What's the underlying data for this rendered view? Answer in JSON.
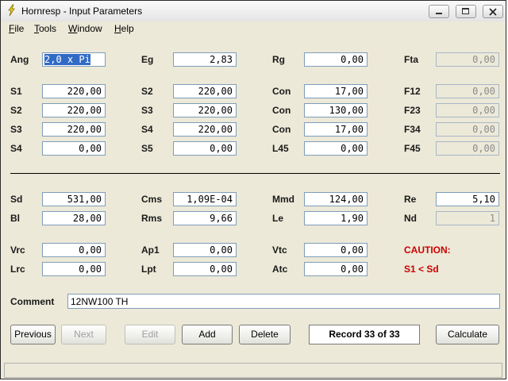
{
  "window": {
    "title": "Hornresp - Input Parameters"
  },
  "menu": [
    "File",
    "Tools",
    "Window",
    "Help"
  ],
  "params": [
    {
      "label": "Ang",
      "value": "2,0 x Pi",
      "state": "selected"
    },
    {
      "label": "Eg",
      "value": "2,83",
      "state": "normal"
    },
    {
      "label": "Rg",
      "value": "0,00",
      "state": "normal"
    },
    {
      "label": "Fta",
      "value": "0,00",
      "state": "disabled"
    },
    {
      "label": "S1",
      "value": "220,00",
      "state": "normal"
    },
    {
      "label": "S2",
      "value": "220,00",
      "state": "normal"
    },
    {
      "label": "Con",
      "value": "17,00",
      "state": "normal"
    },
    {
      "label": "F12",
      "value": "0,00",
      "state": "disabled"
    },
    {
      "label": "S2",
      "value": "220,00",
      "state": "normal"
    },
    {
      "label": "S3",
      "value": "220,00",
      "state": "normal"
    },
    {
      "label": "Con",
      "value": "130,00",
      "state": "normal"
    },
    {
      "label": "F23",
      "value": "0,00",
      "state": "disabled"
    },
    {
      "label": "S3",
      "value": "220,00",
      "state": "normal"
    },
    {
      "label": "S4",
      "value": "220,00",
      "state": "normal"
    },
    {
      "label": "Con",
      "value": "17,00",
      "state": "normal"
    },
    {
      "label": "F34",
      "value": "0,00",
      "state": "disabled"
    },
    {
      "label": "S4",
      "value": "0,00",
      "state": "normal"
    },
    {
      "label": "S5",
      "value": "0,00",
      "state": "normal"
    },
    {
      "label": "L45",
      "value": "0,00",
      "state": "normal"
    },
    {
      "label": "F45",
      "value": "0,00",
      "state": "disabled"
    },
    {
      "label": "Sd",
      "value": "531,00",
      "state": "normal"
    },
    {
      "label": "Cms",
      "value": "1,09E-04",
      "state": "normal"
    },
    {
      "label": "Mmd",
      "value": "124,00",
      "state": "normal"
    },
    {
      "label": "Re",
      "value": "5,10",
      "state": "normal"
    },
    {
      "label": "Bl",
      "value": "28,00",
      "state": "normal"
    },
    {
      "label": "Rms",
      "value": "9,66",
      "state": "normal"
    },
    {
      "label": "Le",
      "value": "1,90",
      "state": "normal"
    },
    {
      "label": "Nd",
      "value": "1",
      "state": "disabled"
    },
    {
      "label": "Vrc",
      "value": "0,00",
      "state": "normal"
    },
    {
      "label": "Ap1",
      "value": "0,00",
      "state": "normal"
    },
    {
      "label": "Vtc",
      "value": "0,00",
      "state": "normal"
    },
    {
      "label": "Lrc",
      "value": "0,00",
      "state": "normal"
    },
    {
      "label": "Lpt",
      "value": "0,00",
      "state": "normal"
    },
    {
      "label": "Atc",
      "value": "0,00",
      "state": "normal"
    }
  ],
  "caution": {
    "title": "CAUTION:",
    "message": "S1 < Sd",
    "color": "#cc0000"
  },
  "comment": {
    "label": "Comment",
    "value": "12NW100 TH"
  },
  "buttons": {
    "previous": "Previous",
    "next": "Next",
    "edit": "Edit",
    "add": "Add",
    "delete": "Delete",
    "calculate": "Calculate"
  },
  "record": "Record 33 of 33",
  "status": {
    "text": ""
  }
}
